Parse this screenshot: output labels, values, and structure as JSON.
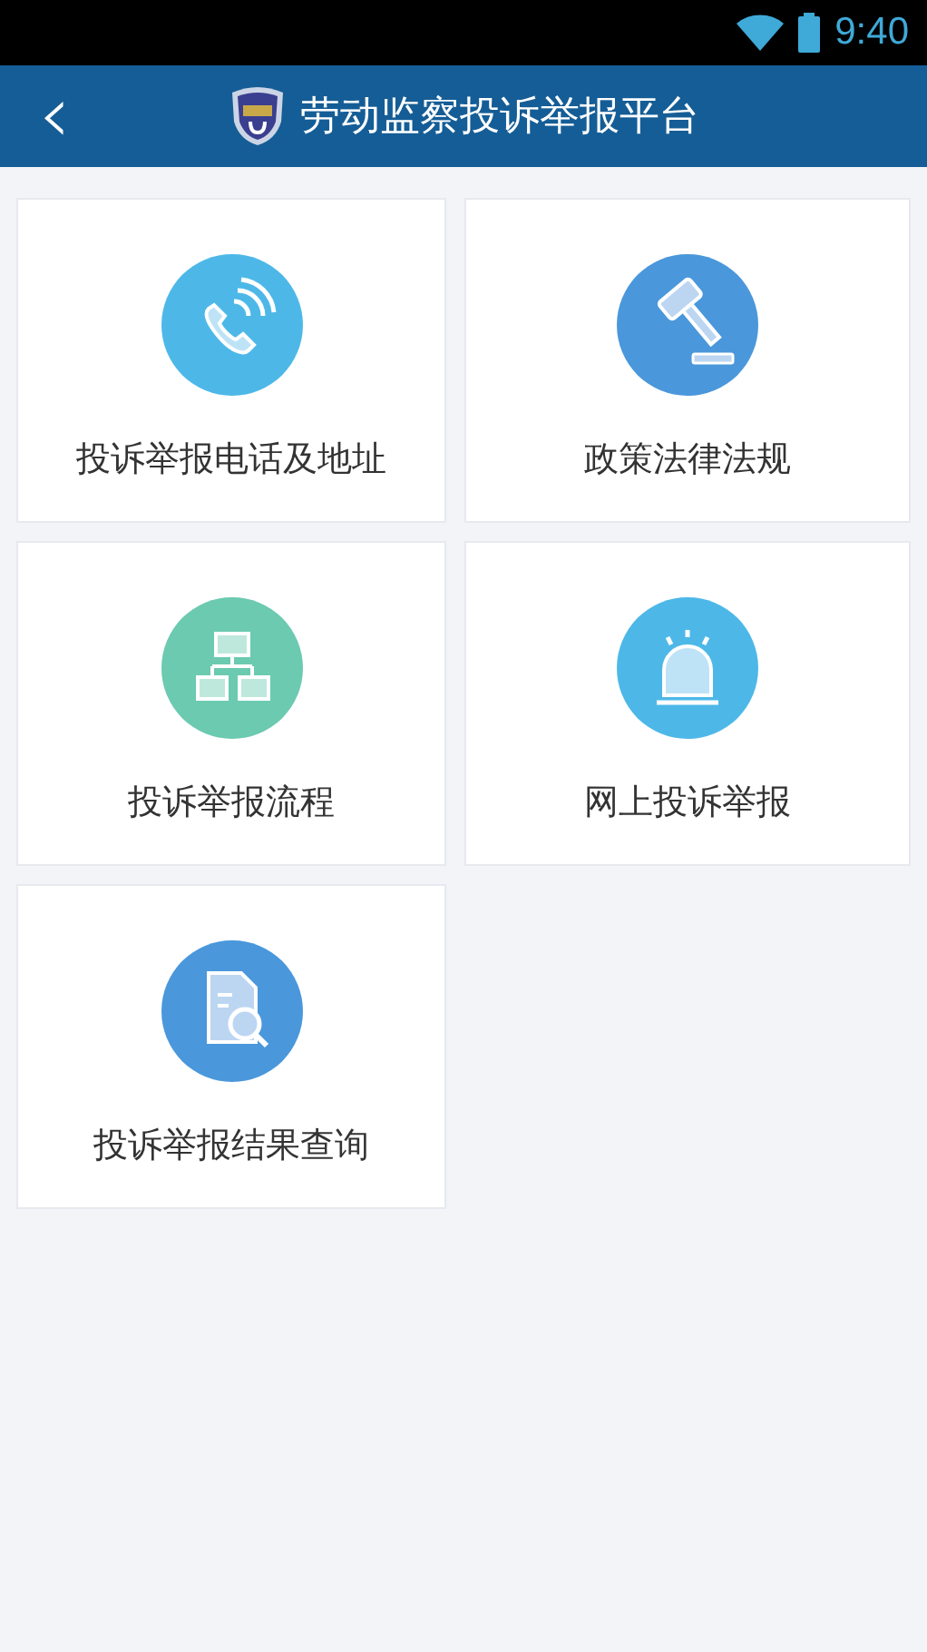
{
  "status_bar": {
    "time": "9:40"
  },
  "header": {
    "back": "‹",
    "title": "劳动监察投诉举报平台"
  },
  "tiles": [
    {
      "label": "投诉举报电话及地址",
      "kind": "phone",
      "color": "#4db8e8"
    },
    {
      "label": "政策法律法规",
      "kind": "gavel",
      "color": "#4a97db"
    },
    {
      "label": "投诉举报流程",
      "kind": "flow",
      "color": "#6bcab0"
    },
    {
      "label": "网上投诉举报",
      "kind": "alarm",
      "color": "#4db8e8"
    },
    {
      "label": "投诉举报结果查询",
      "kind": "search",
      "color": "#4a97db"
    }
  ]
}
